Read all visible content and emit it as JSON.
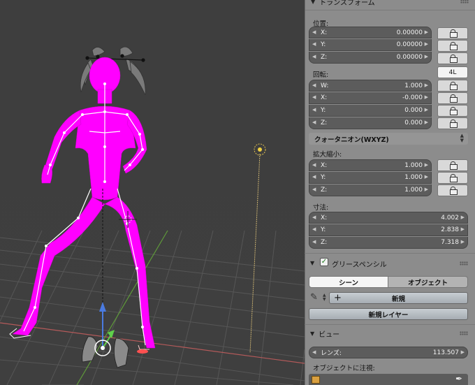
{
  "viewport": {
    "armature_color": "#ff00ff",
    "grid_color": "#555555",
    "x_axis_color": "#c85a5a",
    "y_axis_color": "#6aa040",
    "z_axis_color": "#4a7ae0"
  },
  "panel": {
    "transform": {
      "header": "トランスフォーム",
      "location_label": "位置:",
      "location": [
        {
          "axis": "X:",
          "value": "0.00000"
        },
        {
          "axis": "Y:",
          "value": "0.00000"
        },
        {
          "axis": "Z:",
          "value": "0.00000"
        }
      ],
      "rotation_label": "回転:",
      "rotation_mode_button": "4L",
      "rotation": [
        {
          "axis": "W:",
          "value": "1.000"
        },
        {
          "axis": "X:",
          "value": "-0.000"
        },
        {
          "axis": "Y:",
          "value": "0.000"
        },
        {
          "axis": "Z:",
          "value": "0.000"
        }
      ],
      "rotation_mode": "クォータニオン(WXYZ)",
      "scale_label": "拡大縮小:",
      "scale": [
        {
          "axis": "X:",
          "value": "1.000"
        },
        {
          "axis": "Y:",
          "value": "1.000"
        },
        {
          "axis": "Z:",
          "value": "1.000"
        }
      ],
      "dimensions_label": "寸法:",
      "dimensions": [
        {
          "axis": "X:",
          "value": "4.002"
        },
        {
          "axis": "Y:",
          "value": "2.838"
        },
        {
          "axis": "Z:",
          "value": "7.318"
        }
      ]
    },
    "grease_pencil": {
      "header": "グリースペンシル",
      "enabled": true,
      "tab_scene": "シーン",
      "tab_object": "オブジェクト",
      "new_button": "新規",
      "new_layer_button": "新規レイヤー"
    },
    "view": {
      "header": "ビュー",
      "lens_label": "レンズ:",
      "lens_value": "113.507",
      "lock_to_object_label": "オブジェクトに注視:"
    }
  }
}
